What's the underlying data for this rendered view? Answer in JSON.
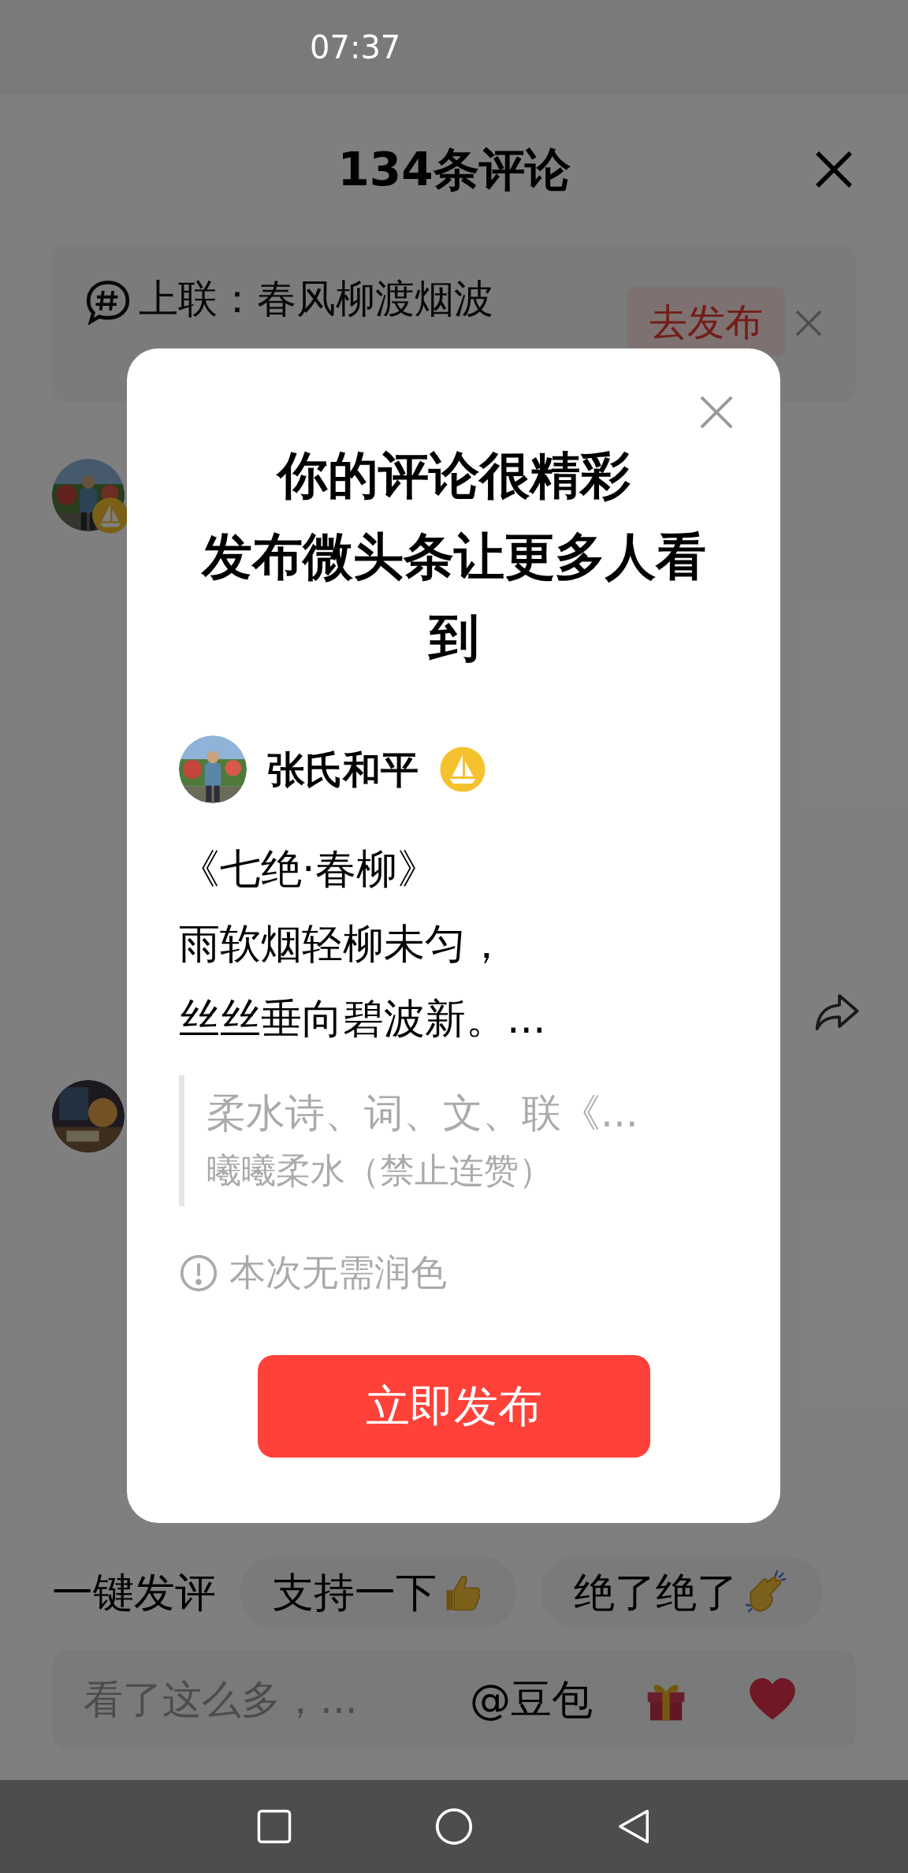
{
  "status_bar": {
    "time": "07:37"
  },
  "sheet": {
    "title": "134条评论"
  },
  "topic_banner": {
    "text": "上联：春风柳渡烟波",
    "button": "去发布"
  },
  "comments": [
    {
      "avatar_badge": true
    },
    {
      "avatar_badge": false
    }
  ],
  "quick_replies": {
    "label": "一键发评",
    "chips": [
      {
        "text": "支持一下",
        "kind": "thumbs-up"
      },
      {
        "text": "绝了绝了",
        "kind": "clap"
      }
    ]
  },
  "input_bar": {
    "placeholder": "看了这么多，...",
    "mention": "@豆包"
  },
  "dialog": {
    "title_lines": [
      "你的评论很精彩",
      "发布微头条让更多人看到"
    ],
    "author": {
      "name": "张氏和平",
      "badge": true
    },
    "poem_lines": [
      "《七绝·春柳》",
      "雨软烟轻柳未匀，",
      "丝丝垂向碧波新。..."
    ],
    "quote": {
      "title": "柔水诗、词、文、联《...",
      "author": "曦曦柔水（禁止连赞）"
    },
    "hint": "本次无需润色",
    "button": "立即发布"
  }
}
